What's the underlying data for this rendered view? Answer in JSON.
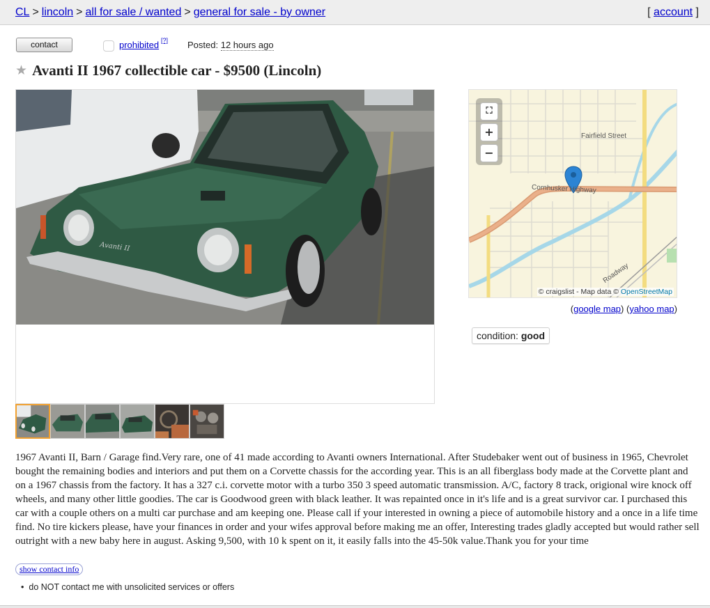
{
  "breadcrumb": {
    "items": [
      "CL",
      "lincoln",
      "all for sale / wanted",
      "general for sale - by owner"
    ],
    "separator": ">"
  },
  "account": {
    "open": "[",
    "label": "account",
    "close": "]"
  },
  "post_header": {
    "contact_label": "contact",
    "prohibited_label": "prohibited",
    "help_marker": "[?]",
    "posted_label": "Posted:",
    "posted_ago": "12 hours ago"
  },
  "posting": {
    "star_icon": "star-icon",
    "title": "Avanti II 1967 collectible car - $9500 (Lincoln)"
  },
  "gallery": {
    "thumbnail_count": 6,
    "selected_index": 0,
    "car_color": "#2f5a44"
  },
  "map": {
    "streets": [
      "Fairfield Street",
      "Cornhusker Highway",
      "Roadway"
    ],
    "controls": {
      "fullscreen_icon": "fullscreen-icon",
      "zoom_in": "+",
      "zoom_out": "−"
    },
    "attribution": {
      "prefix": "© craigslist - Map data ©",
      "osm": "OpenStreetMap"
    },
    "links": {
      "open": "(",
      "google": "google map",
      "mid": ") (",
      "yahoo": "yahoo map",
      "close": ")"
    },
    "colors": {
      "land": "#f8f4de",
      "highway": "#e8a77e",
      "river": "#a6d7e8",
      "secondary": "#f3dc80"
    }
  },
  "attributes": {
    "label": "condition:",
    "value": "good"
  },
  "body_text": "1967 Avanti II, Barn / Garage find.Very rare, one of 41 made according to Avanti owners International. After Studebaker went out of business in 1965, Chevrolet bought the remaining bodies and interiors and put them on a Corvette chassis for the according year. This is an all fiberglass body made at the Corvette plant and on a 1967 chassis from the factory. It has a 327 c.i. corvette motor with a turbo 350 3 speed automatic transmission. A/C, factory 8 track, origional wire knock off wheels, and many other little goodies. The car is Goodwood green with black leather. It was repainted once in it's life and is a great survivor car. I purchased this car with a couple others on a multi car purchase and am keeping one. Please call if your interested in owning a piece of automobile history and a once in a life time find. No tire kickers please, have your finances in order and your wifes approval before making me an offer, Interesting trades gladly accepted but would rather sell outright with a new baby here in august. Asking 9,500, with 10 k spent on it, it easily falls into the 45-50k value.Thank you for your time",
  "show_contact_label": "show contact info",
  "notices": [
    "do NOT contact me with unsolicited services or offers"
  ],
  "colors": {
    "link": "#0000cc",
    "topbar": "#eeeeee",
    "selected_thumb_border": "#f0a030"
  }
}
